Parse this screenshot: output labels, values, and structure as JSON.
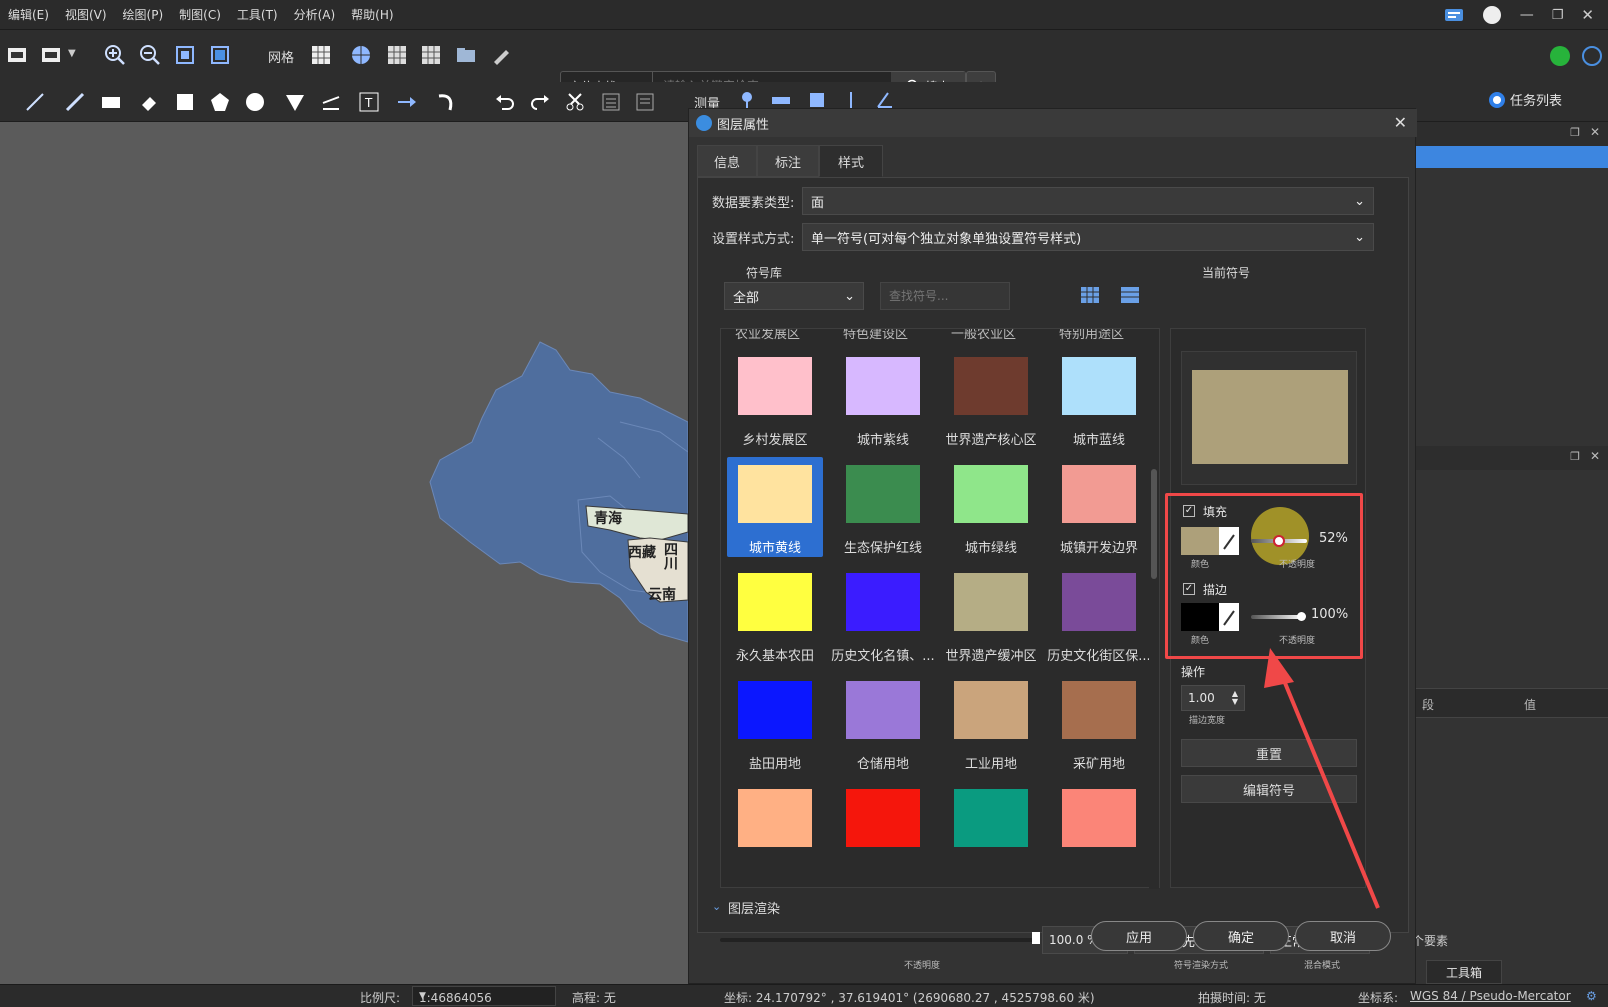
{
  "menu": [
    "编辑(E)",
    "视图(V)",
    "绘图(P)",
    "制图(C)",
    "工具(T)",
    "分析(A)",
    "帮助(H)"
  ],
  "toolbar": {
    "grid_label": "网格",
    "locate_label": "定位查找",
    "search_placeholder": "请输入关键字检索",
    "search_label": "搜索",
    "measure_label": "测量",
    "task_list": "任务列表"
  },
  "dialog": {
    "title": "图层属性",
    "tabs": [
      "信息",
      "标注",
      "样式"
    ],
    "feature_type_label": "数据要素类型:",
    "feature_type_value": "面",
    "style_mode_label": "设置样式方式:",
    "style_mode_value": "单一符号(可对每个独立对象单独设置符号样式)",
    "lib_title": "符号库",
    "lib_filter": "全部",
    "lib_search_placeholder": "查找符号...",
    "partial_row": [
      "农业发展区",
      "特色建设区",
      "一般农业区",
      "特别用途区"
    ],
    "symbols": [
      {
        "label": "乡村发展区",
        "color": "#ffc0cb"
      },
      {
        "label": "城市紫线",
        "color": "#d7b8ff"
      },
      {
        "label": "世界遗产核心区",
        "color": "#6e3b2e"
      },
      {
        "label": "城市蓝线",
        "color": "#aee0fb"
      },
      {
        "label": "城市黄线",
        "color": "#ffe39f"
      },
      {
        "label": "生态保护红线",
        "color": "#3b8c4f"
      },
      {
        "label": "城市绿线",
        "color": "#8fe68a"
      },
      {
        "label": "城镇开发边界",
        "color": "#f29b93"
      },
      {
        "label": "永久基本农田",
        "color": "#ffff40"
      },
      {
        "label": "历史文化名镇、...",
        "color": "#3b1cff"
      },
      {
        "label": "世界遗产缓冲区",
        "color": "#b5ad85"
      },
      {
        "label": "历史文化街区保...",
        "color": "#7a4b99"
      },
      {
        "label": "盐田用地",
        "color": "#0b17ff"
      },
      {
        "label": "仓储用地",
        "color": "#9a78d8"
      },
      {
        "label": "工业用地",
        "color": "#caa47c"
      },
      {
        "label": "采矿用地",
        "color": "#a66e4e"
      },
      {
        "label": "",
        "color": "#ffb084"
      },
      {
        "label": "",
        "color": "#f5160c"
      },
      {
        "label": "",
        "color": "#0a9b80"
      },
      {
        "label": "",
        "color": "#fb8578"
      }
    ],
    "selected_index": 4,
    "current_symbol_title": "当前符号",
    "current_symbol_color": "#ada07a",
    "fill_label": "填充",
    "fill_color_sub": "颜色",
    "fill_opacity": "52%",
    "opacity_sub": "不透明度",
    "stroke_label": "描边",
    "stroke_color_sub": "颜色",
    "stroke_opacity": "100%",
    "stroke_opacity_sub": "不透明度",
    "operation_label": "操作",
    "stroke_width": "1.00",
    "stroke_width_sub": "描边宽度",
    "reset_label": "重置",
    "edit_label": "编辑符号",
    "render_title": "图层渲染",
    "render_opacity": "100.0 %",
    "render_opacity_sub": "不透明度",
    "render_order": "要素优先",
    "render_order_sub": "符号渲染方式",
    "blend": "正常",
    "blend_sub": "混合模式",
    "apply": "应用",
    "ok": "确定",
    "cancel": "取消"
  },
  "map_labels": [
    "青海",
    "西藏",
    "四川",
    "云南"
  ],
  "right_panel": {
    "col1": "段",
    "col2": "值",
    "count": "个要素",
    "toolbox": "工具箱"
  },
  "status": {
    "scale_label": "比例尺:",
    "scale_value": "1:46864056",
    "elev": "高程: 无",
    "coord": "坐标: 24.170792° , 37.619401°  (2690680.27 , 4525798.60 米)",
    "shot_time": "拍摄时间: 无",
    "crs_label": "坐标系:",
    "crs_value": "WGS 84 / Pseudo-Mercator"
  }
}
